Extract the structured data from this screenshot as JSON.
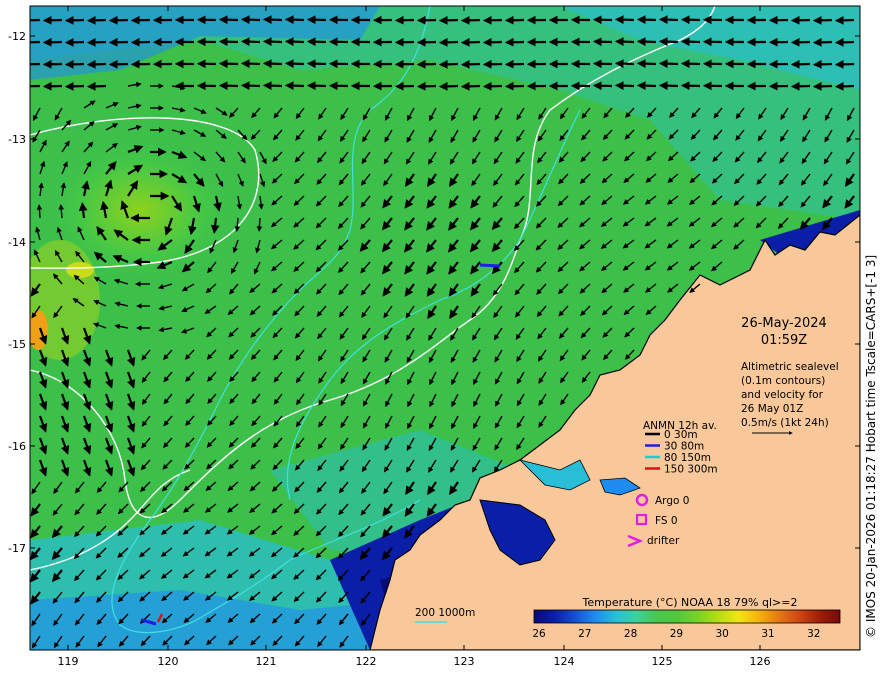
{
  "header": {
    "date": "26-May-2024",
    "time": "01:59Z"
  },
  "altimetry_note": {
    "line1": "Altimetric sealevel",
    "line2": "(0.1m contours)",
    "line3": "and velocity for",
    "line4": "26 May 01Z",
    "line5": "0.5m/s (1kt 24h)"
  },
  "legend": {
    "title": "ANMN 12h av.",
    "items": [
      {
        "label": "0 30m",
        "color": "#000000"
      },
      {
        "label": "30 80m",
        "color": "#1e1ee6"
      },
      {
        "label": "80 150m",
        "color": "#22cccc"
      },
      {
        "label": "150 300m",
        "color": "#e01010"
      }
    ],
    "argo_label": "Argo 0",
    "fs_label": "FS 0",
    "drifter_label": "drifter",
    "marker_color": "#e020e0"
  },
  "bathymetry_label": "200  1000m",
  "colorbar": {
    "title": "Temperature (°C) NOAA 18 79% ql>=2",
    "ticks": [
      "26",
      "27",
      "28",
      "29",
      "30",
      "31",
      "32"
    ],
    "colors": [
      "#0a0a7a",
      "#0a1ea8",
      "#1450d2",
      "#1e8cf0",
      "#28bed8",
      "#3cd2a0",
      "#46c850",
      "#50c83c",
      "#78d228",
      "#b4dc14",
      "#f0e614",
      "#f5b40a",
      "#e67814",
      "#cd4614",
      "#a01e0a",
      "#780a0a"
    ]
  },
  "axes": {
    "x_ticks": [
      "119",
      "120",
      "121",
      "122",
      "123",
      "124",
      "125",
      "126"
    ],
    "y_ticks": [
      "-12",
      "-13",
      "-14",
      "-15",
      "-16",
      "-17"
    ]
  },
  "side_caption": "© IMOS 20-Jan-2026 01:18:27 Hobart time Tscale=CARS+[-1 3]",
  "colors": {
    "land": "#f8c89a",
    "ocean_green": "#3cc04a",
    "ocean_cyan": "#2ab8c8",
    "deep_blue": "#0a1e8c",
    "contour_white": "#ffffff",
    "contour_cyan": "#40e0e0"
  }
}
